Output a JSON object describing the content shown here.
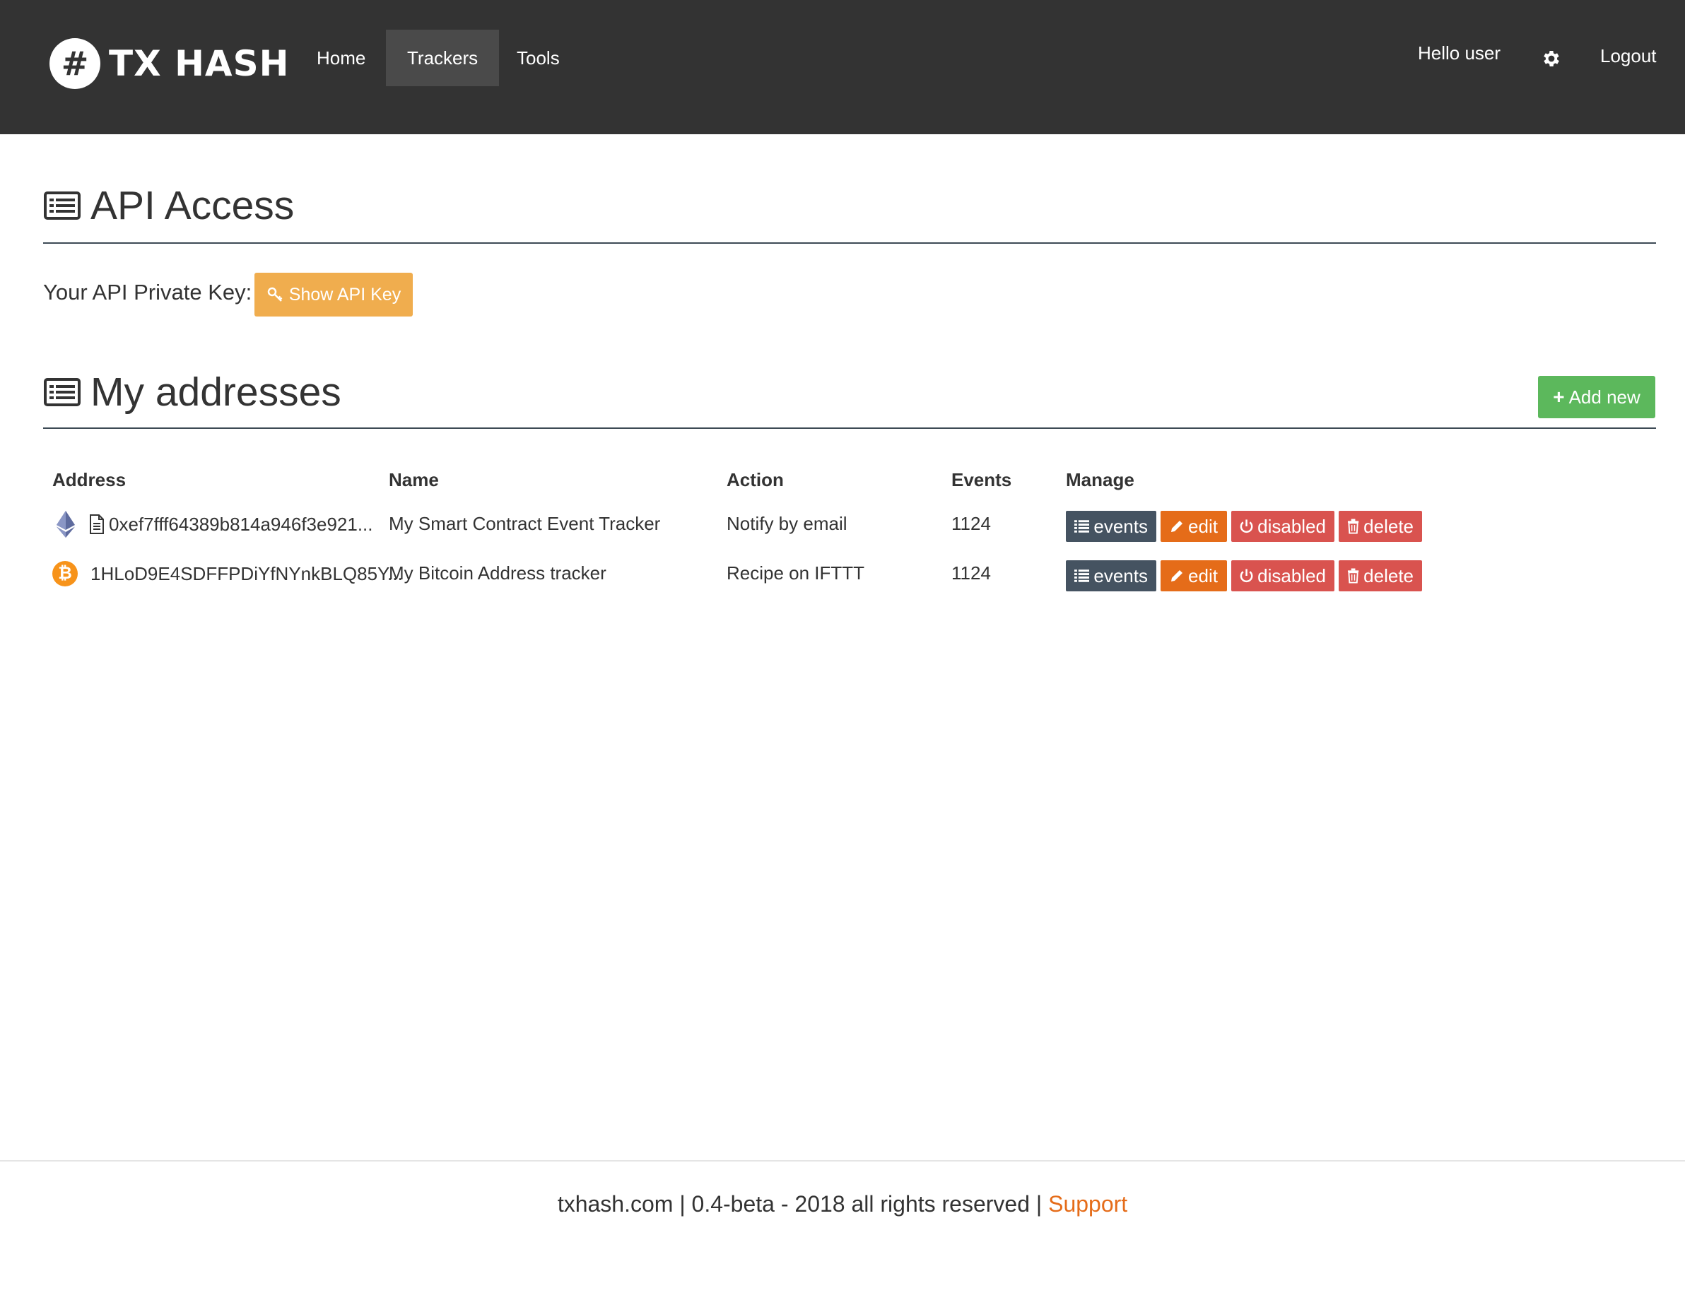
{
  "nav": {
    "brand_symbol": "#",
    "brand": "TX HASH",
    "links": [
      "Home",
      "Trackers",
      "Tools"
    ],
    "active": "Trackers",
    "greeting": "Hello user",
    "logout": "Logout",
    "settings_icon": "gear-icon"
  },
  "api": {
    "title": "API Access",
    "key_label": "Your API Private Key:",
    "show_key_button": "Show API Key",
    "button_color": "#f0ad4e"
  },
  "addresses": {
    "title": "My addresses",
    "add_button": "Add new",
    "add_button_color": "#5cb85c",
    "columns": [
      "Address",
      "Name",
      "Action",
      "Events",
      "Manage"
    ],
    "rows": [
      {
        "coin_icon": "ethereum-icon",
        "type_icon": "document-icon",
        "address": "0xef7fff64389b814a946f3e921...",
        "name": "My Smart Contract Event Tracker",
        "action": "Notify by email",
        "events": "1124"
      },
      {
        "coin_icon": "bitcoin-icon",
        "coin_symbol": "₿",
        "address": "1HLoD9E4SDFFPDiYfNYnkBLQ85Y...",
        "name": "My Bitcoin Address tracker",
        "action": "Recipe on IFTTT",
        "events": "1124"
      }
    ],
    "manage_buttons": {
      "events": "events",
      "edit": "edit",
      "disabled": "disabled",
      "delete": "delete"
    },
    "manage_colors": {
      "events": "#455361",
      "edit": "#e56c19",
      "disabled": "#d9534f",
      "delete": "#d9534f"
    }
  },
  "footer": {
    "text": "txhash.com | 0.4-beta - 2018 all rights reserved | ",
    "support_link": "Support",
    "link_color": "#e56c19"
  }
}
